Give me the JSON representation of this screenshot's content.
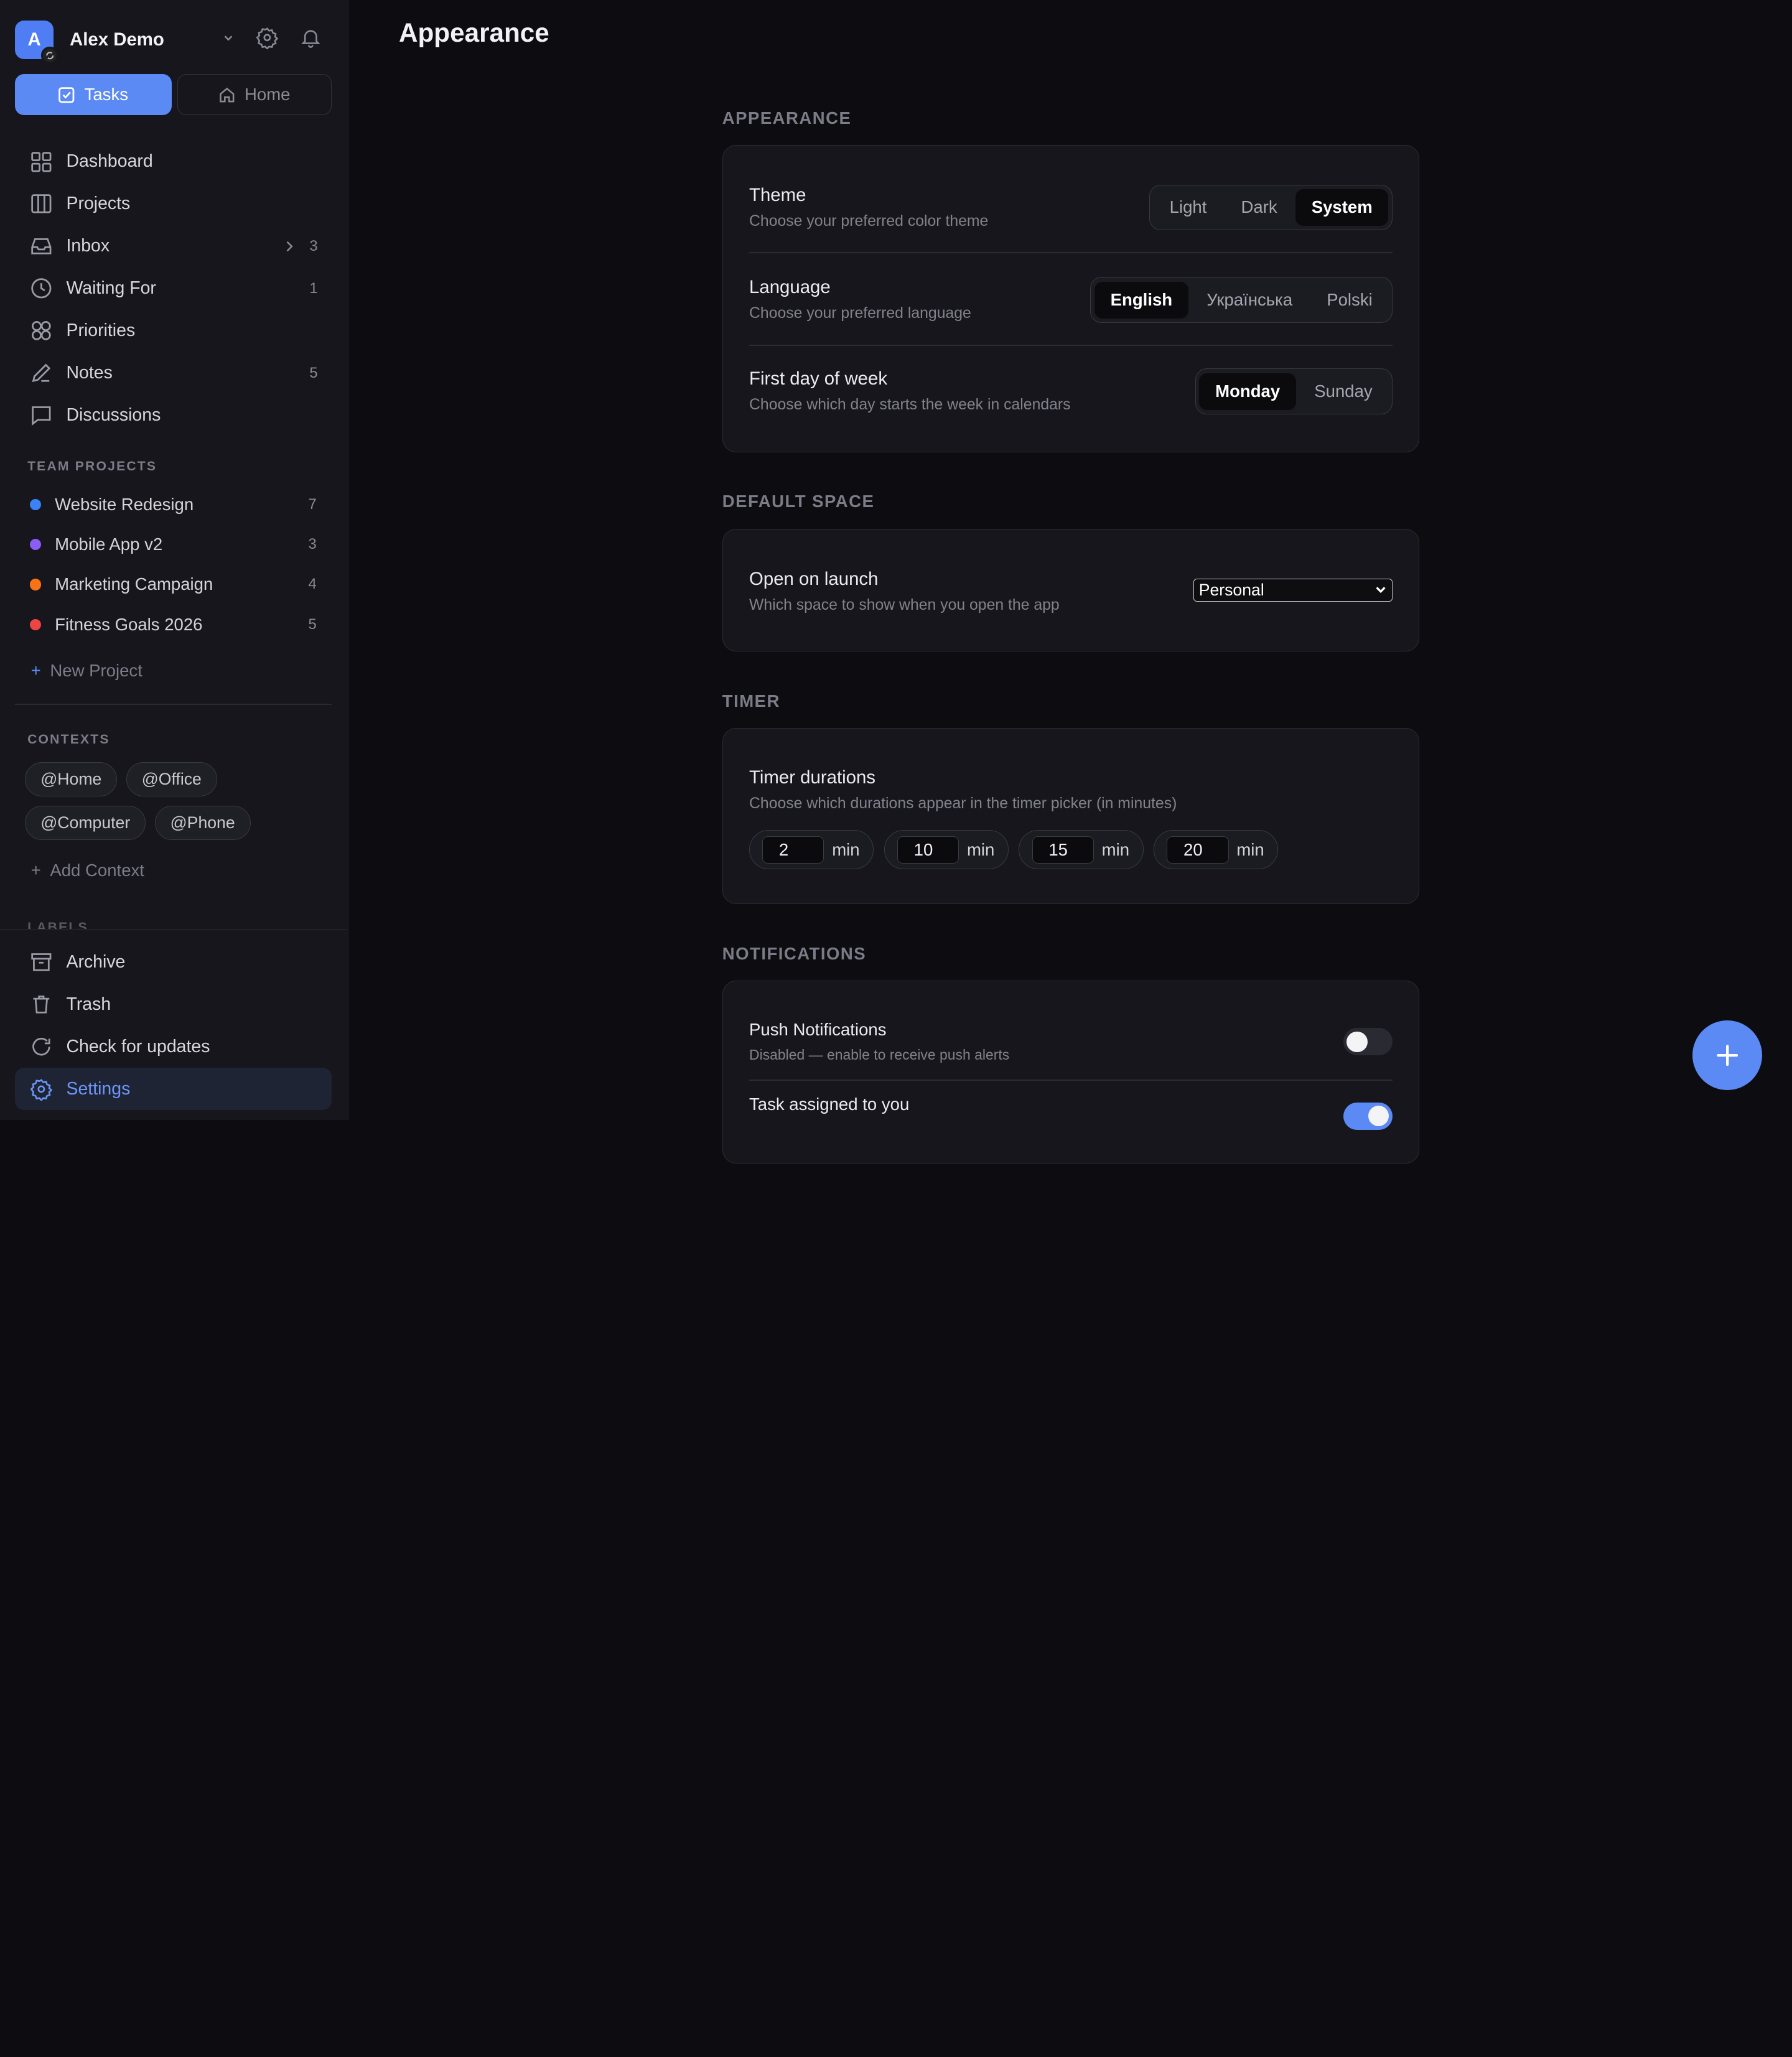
{
  "account": {
    "initial": "A",
    "name": "Alex Demo"
  },
  "top_buttons": {
    "tasks": "Tasks",
    "home": "Home"
  },
  "nav": [
    {
      "label": "Dashboard",
      "icon": "grid-icon",
      "count": ""
    },
    {
      "label": "Projects",
      "icon": "columns-icon",
      "count": ""
    },
    {
      "label": "Inbox",
      "icon": "inbox-icon",
      "count": "3"
    },
    {
      "label": "Waiting For",
      "icon": "clock-icon",
      "count": "1"
    },
    {
      "label": "Priorities",
      "icon": "priorities-icon",
      "count": ""
    },
    {
      "label": "Notes",
      "icon": "pen-icon",
      "count": "5"
    },
    {
      "label": "Discussions",
      "icon": "chat-icon",
      "count": ""
    }
  ],
  "team_projects": {
    "title": "TEAM PROJECTS",
    "items": [
      {
        "label": "Website Redesign",
        "color": "#3b82f6",
        "count": "7"
      },
      {
        "label": "Mobile App v2",
        "color": "#8b5cf6",
        "count": "3"
      },
      {
        "label": "Marketing Campaign",
        "color": "#f97316",
        "count": "4"
      },
      {
        "label": "Fitness Goals 2026",
        "color": "#ef4444",
        "count": "5"
      }
    ],
    "new_label": "New Project"
  },
  "contexts": {
    "title": "CONTEXTS",
    "items": [
      "@Home",
      "@Office",
      "@Computer",
      "@Phone"
    ],
    "add_label": "Add Context"
  },
  "labels_title": "LABELS",
  "bottom_nav": [
    {
      "label": "Archive",
      "icon": "archive-icon"
    },
    {
      "label": "Trash",
      "icon": "trash-icon"
    },
    {
      "label": "Check for updates",
      "icon": "refresh-icon"
    },
    {
      "label": "Settings",
      "icon": "settings-icon"
    }
  ],
  "page_title": "Appearance",
  "appearance": {
    "header": "APPEARANCE",
    "theme": {
      "title": "Theme",
      "desc": "Choose your preferred color theme",
      "options": [
        "Light",
        "Dark",
        "System"
      ],
      "selected": "System"
    },
    "language": {
      "title": "Language",
      "desc": "Choose your preferred language",
      "options": [
        "English",
        "Українська",
        "Polski"
      ],
      "selected": "English"
    },
    "week": {
      "title": "First day of week",
      "desc": "Choose which day starts the week in calendars",
      "options": [
        "Monday",
        "Sunday"
      ],
      "selected": "Monday"
    }
  },
  "default_space": {
    "header": "DEFAULT SPACE",
    "title": "Open on launch",
    "desc": "Which space to show when you open the app",
    "value": "Personal"
  },
  "timer": {
    "header": "TIMER",
    "title": "Timer durations",
    "desc": "Choose which durations appear in the timer picker (in minutes)",
    "values": [
      "2",
      "10",
      "15",
      "20"
    ],
    "unit": "min"
  },
  "notifications": {
    "header": "NOTIFICATIONS",
    "push": {
      "title": "Push Notifications",
      "desc": "Disabled — enable to receive push alerts",
      "on": false
    },
    "assigned": {
      "title": "Task assigned to you",
      "on": true
    }
  },
  "colors": {
    "accent": "#5b8af5",
    "background": "#0d0d11",
    "sidebar": "#16161c"
  }
}
